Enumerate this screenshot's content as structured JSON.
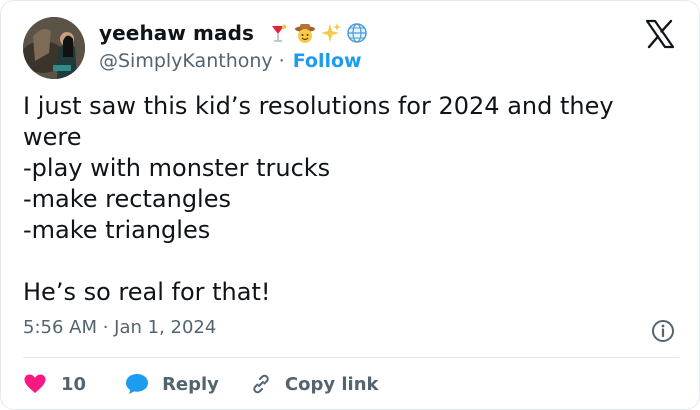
{
  "author": {
    "display_name": "yeehaw mads",
    "emojis": [
      "cocktail-emoji",
      "cowboy-emoji",
      "sparkles-emoji",
      "globe-emoji"
    ],
    "handle": "@SimplyKanthony",
    "separator": "·",
    "follow_label": "Follow"
  },
  "tweet": {
    "text": "I just saw this kid’s resolutions for 2024 and they were\n-play with monster trucks\n-make rectangles\n-make triangles\n\nHe’s so real for that!",
    "timestamp": "5:56 AM · Jan 1, 2024"
  },
  "actions": {
    "like_count": "10",
    "reply_label": "Reply",
    "copy_link_label": "Copy link"
  },
  "colors": {
    "accent": "#1d9bf0",
    "like": "#f91880",
    "secondary_text": "#536471",
    "primary_text": "#0f1419"
  },
  "icons": {
    "platform": "x-logo-icon",
    "info": "info-icon",
    "like": "heart-icon",
    "reply": "speech-bubble-icon",
    "copy_link": "link-icon"
  }
}
